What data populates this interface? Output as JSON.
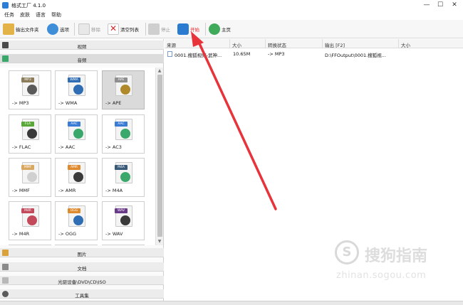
{
  "window": {
    "title": "格式工厂 4.1.0",
    "minimize": "—",
    "maximize": "☐",
    "close": "✕"
  },
  "menu": [
    "任务",
    "皮肤",
    "语言",
    "帮助"
  ],
  "toolbar": {
    "output_folder": "输出文件夹",
    "options": "选项",
    "remove": "移除",
    "clear_list": "清空列表",
    "stop": "停止",
    "start": "开始",
    "home": "主页"
  },
  "categories": {
    "video": "视频",
    "audio": "音频",
    "image": "图片",
    "document": "文档",
    "optical": "光驱设备\\DVD\\CD\\ISO",
    "toolbox": "工具集"
  },
  "formats": [
    {
      "tag": "MP3",
      "label": "-> MP3",
      "tag_color": "#8c7c5a",
      "glyph_color": "#5a5a5a",
      "selected": false
    },
    {
      "tag": "WMA",
      "label": "-> WMA",
      "tag_color": "#2f6db5",
      "glyph_color": "#2f6db5",
      "selected": false
    },
    {
      "tag": "APE",
      "label": "-> APE",
      "tag_color": "#8e8e8e",
      "glyph_color": "#b08a2a",
      "selected": true
    },
    {
      "tag": "FLA",
      "label": "-> FLAC",
      "tag_color": "#5aa83a",
      "glyph_color": "#3a3a3a",
      "selected": false
    },
    {
      "tag": "AAC",
      "label": "-> AAC",
      "tag_color": "#3a7bd5",
      "glyph_color": "#3aa86a",
      "selected": false
    },
    {
      "tag": "AAC",
      "label": "-> AC3",
      "tag_color": "#3a7bd5",
      "glyph_color": "#3aa86a",
      "selected": false
    },
    {
      "tag": "MMF",
      "label": "-> MMF",
      "tag_color": "#d9a860",
      "glyph_color": "#d0d0d0",
      "selected": false
    },
    {
      "tag": "AMR",
      "label": "-> AMR",
      "tag_color": "#e08a2e",
      "glyph_color": "#3a3a3a",
      "selected": false
    },
    {
      "tag": "M4A",
      "label": "-> M4A",
      "tag_color": "#3a5a7a",
      "glyph_color": "#3aa86a",
      "selected": false
    },
    {
      "tag": "M4R",
      "label": "-> M4R",
      "tag_color": "#c24a5a",
      "glyph_color": "#c24a5a",
      "selected": false
    },
    {
      "tag": "OGG",
      "label": "-> OGG",
      "tag_color": "#e08a2e",
      "glyph_color": "#2f6db5",
      "selected": false
    },
    {
      "tag": "WAV",
      "label": "-> WAV",
      "tag_color": "#6a3a8a",
      "glyph_color": "#3a3a3a",
      "selected": false
    }
  ],
  "table": {
    "columns": [
      "来源",
      "大小",
      "转换状态",
      "输出 [F2]",
      "大小"
    ],
    "rows": [
      {
        "source": "0001.搜狐视频-武神...",
        "size": "10.65M",
        "status": "-> MP3",
        "output": "D:\\FFOutput\\0001.搜狐视...",
        "out_size": ""
      }
    ]
  },
  "watermark": {
    "logo": "S",
    "text": "搜狗指南",
    "url": "zhinan.sogou.com"
  },
  "colors": {
    "start_label": "#e8262b",
    "arrow": "#e8333a",
    "selected_tile": "#dadada"
  }
}
